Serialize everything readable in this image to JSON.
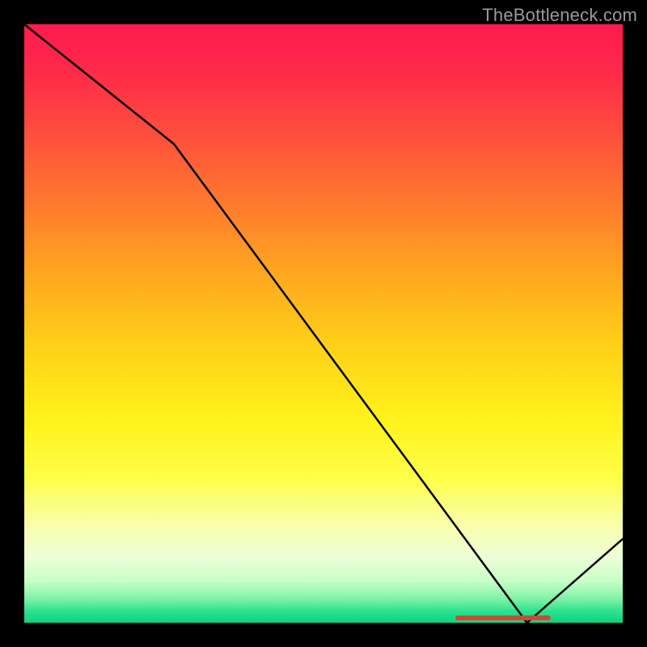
{
  "watermark": "TheBottleneck.com",
  "chart_data": {
    "type": "line",
    "title": "",
    "xlabel": "",
    "ylabel": "",
    "xlim": [
      0,
      100
    ],
    "ylim": [
      0,
      100
    ],
    "x": [
      0,
      25,
      84,
      100
    ],
    "values": [
      100,
      80,
      0,
      14
    ],
    "annotation": {
      "x_start": 72,
      "x_end": 88,
      "y": 0.8,
      "color": "#c94a3b"
    },
    "background_gradient": {
      "top": "#ff1a4d",
      "mid": "#fff21a",
      "bottom": "#0fd183"
    }
  }
}
